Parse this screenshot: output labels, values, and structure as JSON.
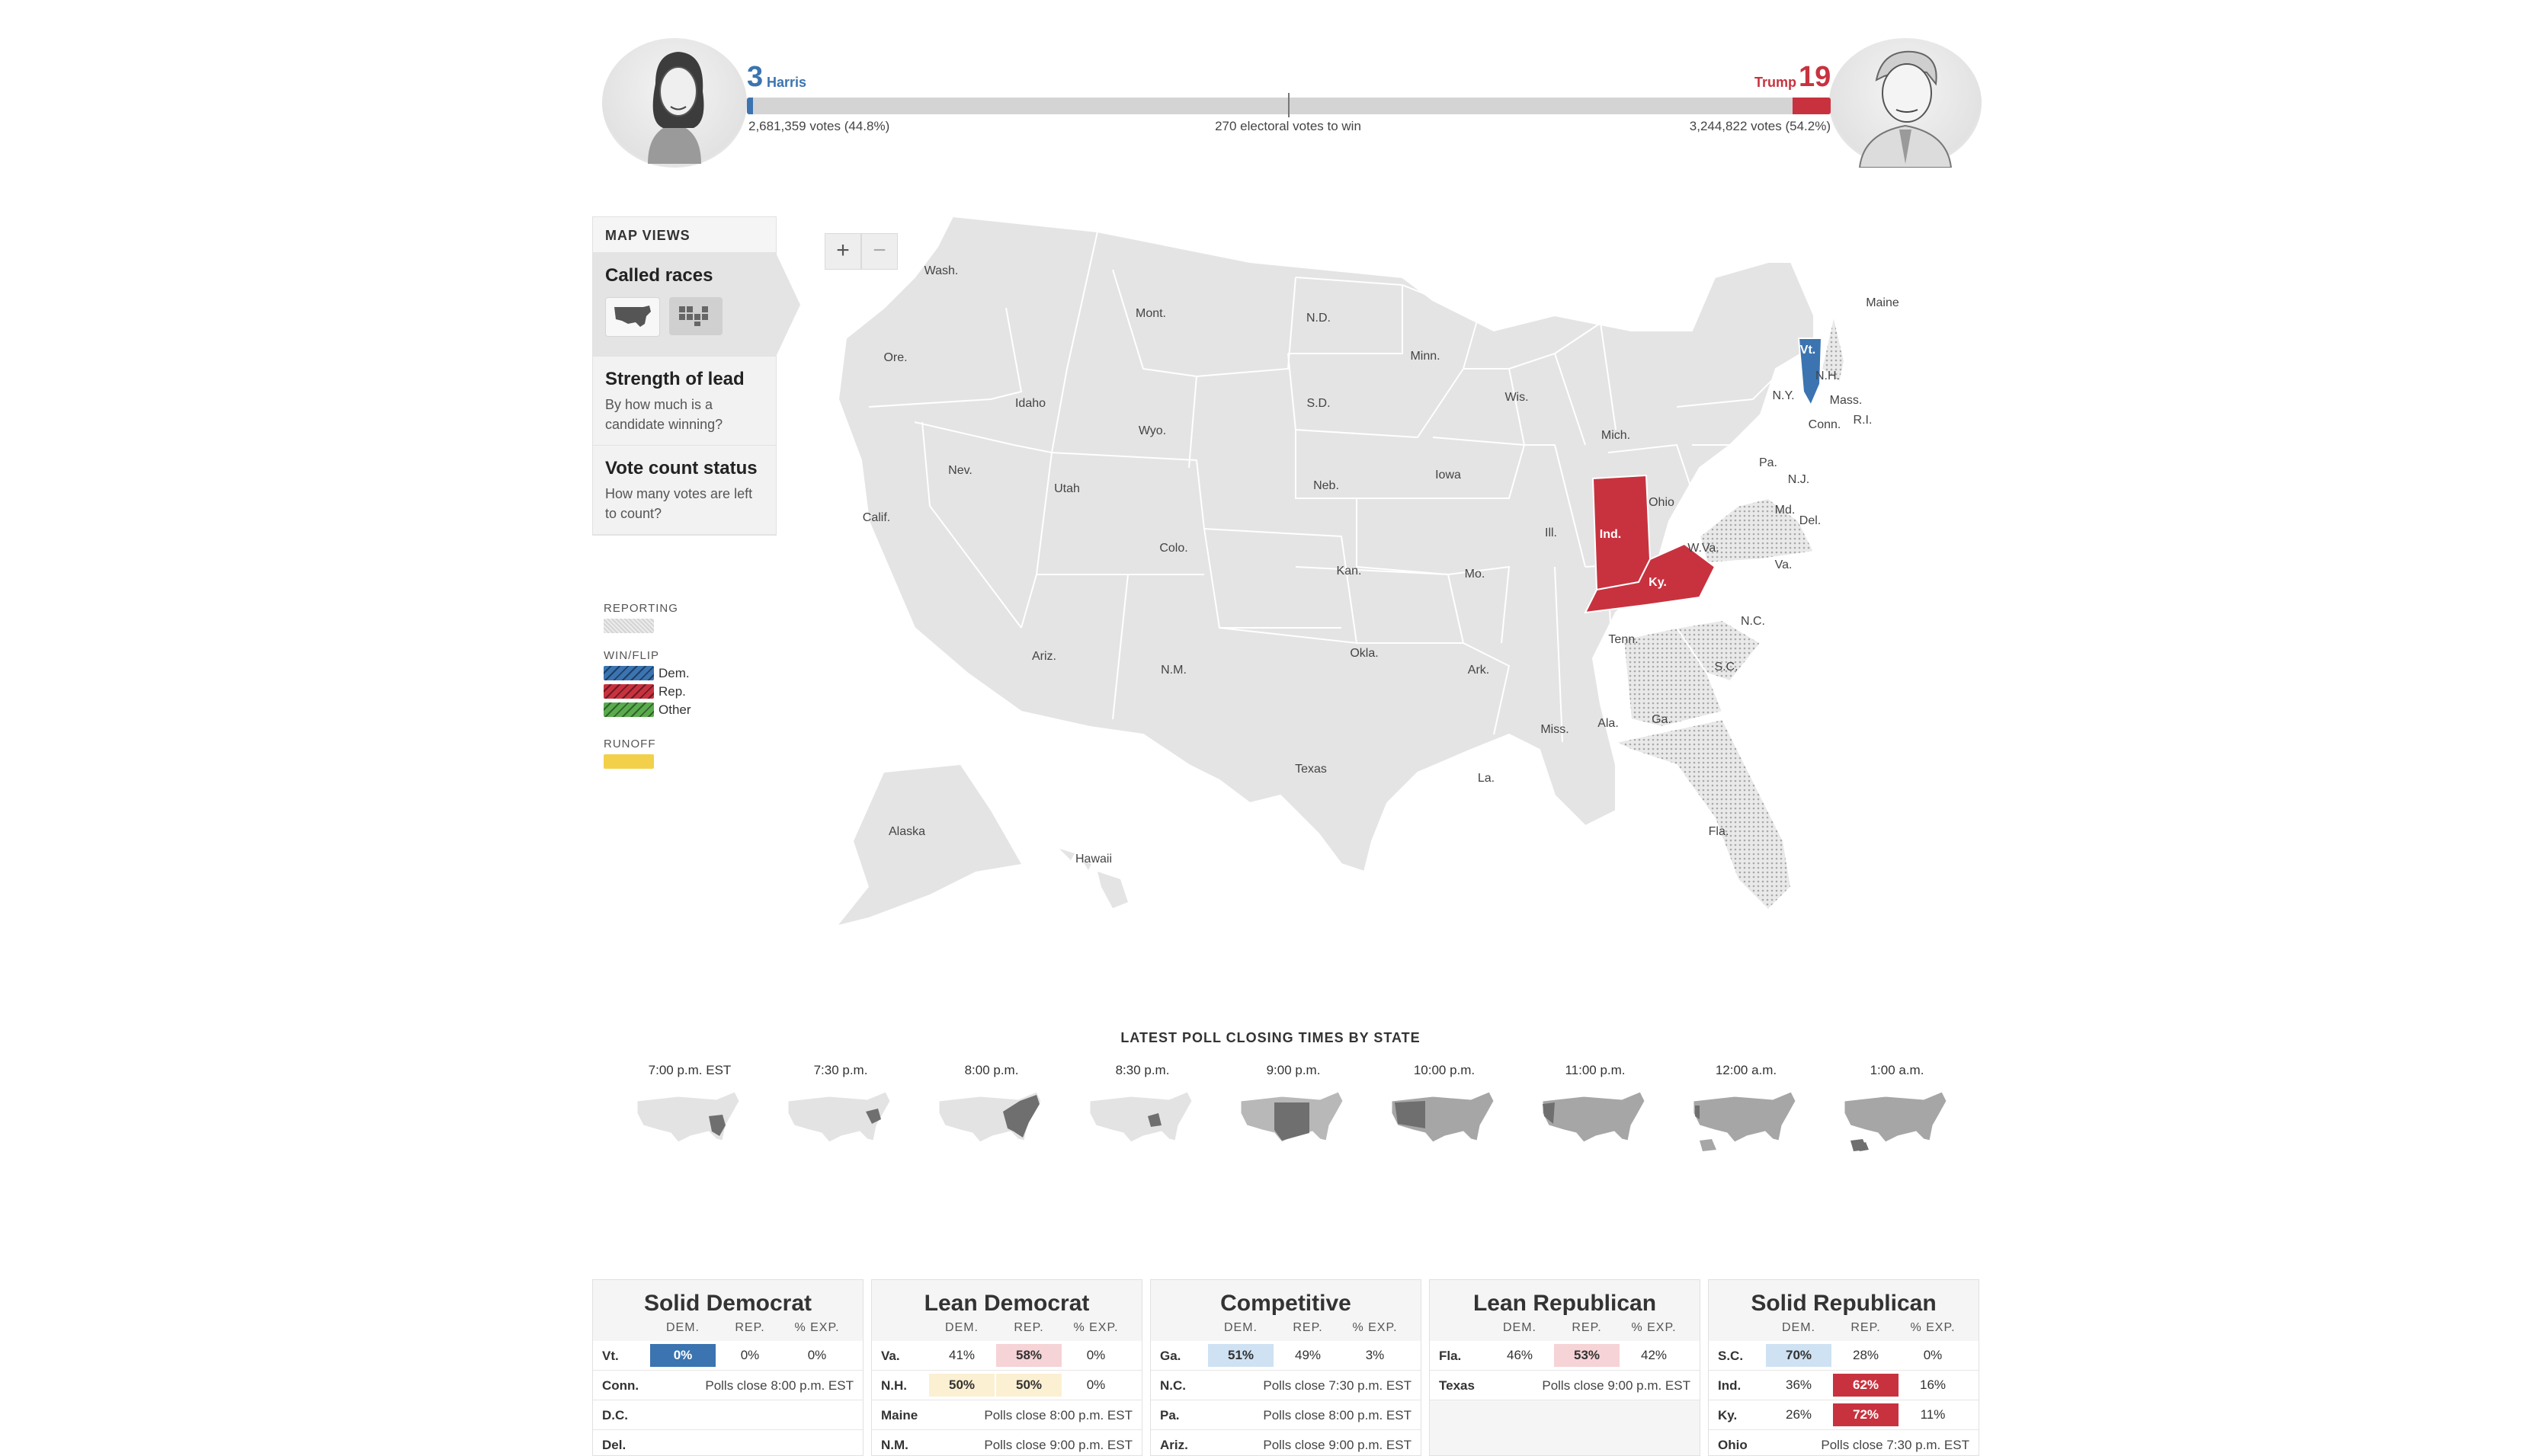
{
  "header": {
    "harris": {
      "ev": "3",
      "name": "Harris",
      "votes": "2,681,359 votes (44.8%)",
      "color": "#3b74b0"
    },
    "trump": {
      "ev": "19",
      "name": "Trump",
      "votes": "3,244,822 votes (54.2%)",
      "color": "#c8323f"
    },
    "to_win": "270 electoral votes to win",
    "dem_fraction": 0.0056,
    "rep_fraction": 0.0353
  },
  "zoom": {
    "plus": "+",
    "minus": "−"
  },
  "panel": {
    "heading": "MAP VIEWS",
    "views": [
      {
        "title": "Called races",
        "sub": "",
        "icons": [
          "us-map-icon",
          "cartogram-icon"
        ]
      },
      {
        "title": "Strength of lead",
        "sub": "By how much is a candidate winning?"
      },
      {
        "title": "Vote count status",
        "sub": "How many votes are left to count?"
      }
    ]
  },
  "legend": {
    "reporting": "REPORTING",
    "winflip": "WIN/FLIP",
    "dem": "Dem.",
    "rep": "Rep.",
    "other": "Other",
    "runoff": "RUNOFF",
    "colors": {
      "reporting": "#dcdcdc",
      "dem": "#3b74b0",
      "rep": "#c8323f",
      "other": "#5aab4e",
      "runoff": "#f2d04a"
    }
  },
  "map": {
    "labels": [
      "Wash.",
      "Ore.",
      "Calif.",
      "Idaho",
      "Nev.",
      "Mont.",
      "Wyo.",
      "Utah",
      "Ariz.",
      "Colo.",
      "N.M.",
      "N.D.",
      "S.D.",
      "Neb.",
      "Kan.",
      "Okla.",
      "Texas",
      "Minn.",
      "Iowa",
      "Mo.",
      "Ark.",
      "La.",
      "Wis.",
      "Ill.",
      "Mich.",
      "Ind.",
      "Ohio",
      "Ky.",
      "Tenn.",
      "Miss.",
      "Ala.",
      "Ga.",
      "Fla.",
      "S.C.",
      "N.C.",
      "Va.",
      "W.Va.",
      "Pa.",
      "N.Y.",
      "Vt.",
      "N.H.",
      "Maine",
      "Mass.",
      "Conn.",
      "R.I.",
      "N.J.",
      "Md.",
      "Del.",
      "Alaska",
      "Hawaii"
    ]
  },
  "poll_closing": {
    "title": "LATEST POLL CLOSING TIMES BY STATE",
    "times": [
      "7:00 p.m. EST",
      "7:30 p.m.",
      "8:00 p.m.",
      "8:30 p.m.",
      "9:00 p.m.",
      "10:00 p.m.",
      "11:00 p.m.",
      "12:00 a.m.",
      "1:00 a.m."
    ]
  },
  "ratings": {
    "col_headers": [
      "DEM.",
      "REP.",
      "% EXP."
    ],
    "groups": [
      {
        "title": "Solid Democrat",
        "rows": [
          {
            "state": "Vt.",
            "dem": "0%",
            "rep": "0%",
            "exp": "0%",
            "lead": "dem-strong"
          },
          {
            "state": "Conn.",
            "note": "Polls close 8:00 p.m. EST"
          },
          {
            "state": "D.C.",
            "note": ""
          },
          {
            "state": "Del.",
            "note": ""
          }
        ]
      },
      {
        "title": "Lean Democrat",
        "rows": [
          {
            "state": "Va.",
            "dem": "41%",
            "rep": "58%",
            "exp": "0%",
            "lead": "rep-light"
          },
          {
            "state": "N.H.",
            "dem": "50%",
            "rep": "50%",
            "exp": "0%",
            "lead": "tie"
          },
          {
            "state": "Maine",
            "note": "Polls close 8:00 p.m. EST"
          },
          {
            "state": "N.M.",
            "note": "Polls close 9:00 p.m. EST"
          }
        ]
      },
      {
        "title": "Competitive",
        "rows": [
          {
            "state": "Ga.",
            "dem": "51%",
            "rep": "49%",
            "exp": "3%",
            "lead": "dem-light"
          },
          {
            "state": "N.C.",
            "note": "Polls close 7:30 p.m. EST"
          },
          {
            "state": "Pa.",
            "note": "Polls close 8:00 p.m. EST"
          },
          {
            "state": "Ariz.",
            "note": "Polls close 9:00 p.m. EST"
          }
        ]
      },
      {
        "title": "Lean Republican",
        "rows": [
          {
            "state": "Fla.",
            "dem": "46%",
            "rep": "53%",
            "exp": "42%",
            "lead": "rep-light"
          },
          {
            "state": "Texas",
            "note": "Polls close 9:00 p.m. EST"
          }
        ]
      },
      {
        "title": "Solid Republican",
        "rows": [
          {
            "state": "S.C.",
            "dem": "70%",
            "rep": "28%",
            "exp": "0%",
            "lead": "dem-light"
          },
          {
            "state": "Ind.",
            "dem": "36%",
            "rep": "62%",
            "exp": "16%",
            "lead": "rep-strong"
          },
          {
            "state": "Ky.",
            "dem": "26%",
            "rep": "72%",
            "exp": "11%",
            "lead": "rep-strong"
          },
          {
            "state": "Ohio",
            "note": "Polls close 7:30 p.m. EST"
          }
        ]
      }
    ]
  }
}
